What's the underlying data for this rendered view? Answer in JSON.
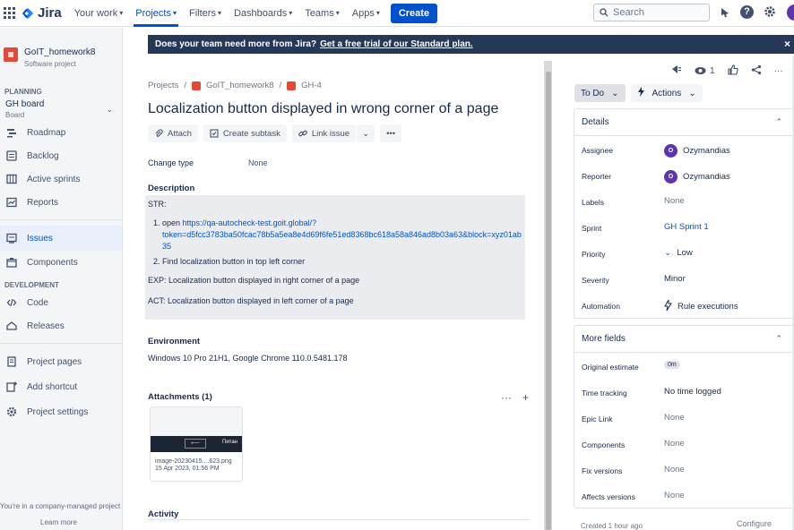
{
  "topnav": {
    "brand": "Jira",
    "items": [
      {
        "label": "Your work",
        "active": false
      },
      {
        "label": "Projects",
        "active": true
      },
      {
        "label": "Filters",
        "active": false
      },
      {
        "label": "Dashboards",
        "active": false
      },
      {
        "label": "Teams",
        "active": false
      },
      {
        "label": "Apps",
        "active": false
      }
    ],
    "create_label": "Create",
    "search_placeholder": "Search"
  },
  "sidebar": {
    "project_name": "GoIT_homework8",
    "project_type": "Software project",
    "planning_label": "PLANNING",
    "board_name": "GH board",
    "board_sub": "Board",
    "planning_items": [
      {
        "label": "Roadmap",
        "icon": "roadmap-icon"
      },
      {
        "label": "Backlog",
        "icon": "backlog-icon"
      },
      {
        "label": "Active sprints",
        "icon": "sprints-icon"
      },
      {
        "label": "Reports",
        "icon": "reports-icon"
      }
    ],
    "issues_label": "Issues",
    "components_label": "Components",
    "development_label": "DEVELOPMENT",
    "dev_items": [
      {
        "label": "Code",
        "icon": "code-icon"
      },
      {
        "label": "Releases",
        "icon": "releases-icon"
      }
    ],
    "bottom_items": [
      {
        "label": "Project pages",
        "icon": "pages-icon"
      },
      {
        "label": "Add shortcut",
        "icon": "add-shortcut-icon"
      },
      {
        "label": "Project settings",
        "icon": "gear-icon"
      }
    ],
    "footer": "You're in a company-managed project",
    "learn_more": "Learn more"
  },
  "banner": {
    "text": "Does your team need more from Jira?",
    "link": "Get a free trial of our Standard plan.",
    "close": "×"
  },
  "issue": {
    "breadcrumb": {
      "projects": "Projects",
      "project": "GoIT_homework8",
      "key": "GH-4",
      "sep": "/"
    },
    "title": "Localization button displayed in wrong corner of a page",
    "actions": {
      "attach": "Attach",
      "subtask": "Create subtask",
      "link": "Link issue",
      "more": "•••"
    },
    "change_type_label": "Change type",
    "change_type_value": "None",
    "description_label": "Description",
    "description": {
      "str": "STR:",
      "step1_prefix": "open ",
      "step1_link_a": "https://qa-autocheck-test.goit.global/?",
      "step1_link_b": "token=d5fcc3783ba50fcac78b5a5ea8e4d69f6fe51ed8368bc618a58a846ad8b03a63&block=xyz01ab",
      "step1_link_c": "35",
      "step2": "Find localization button in top left corner",
      "exp": "EXP: Localization button displayed in right corner of a page",
      "act": "ACT: Localization button displayed in left corner of a page"
    },
    "environment_label": "Environment",
    "environment": "Windows 10 Pro 21H1, Google Chrome 110.0.5481.178",
    "attachments_label": "Attachments (1)",
    "attachment": {
      "name": "image-20230415....623.png",
      "date": "15 Apr 2023, 01:56 PM",
      "thumb_text": "Питан"
    },
    "activity_label": "Activity"
  },
  "right_panel": {
    "watch_count": "1",
    "status": "To Do",
    "actions_label": "Actions",
    "details_label": "Details",
    "details": [
      {
        "label": "Assignee",
        "value": "Ozymandias",
        "type": "user"
      },
      {
        "label": "Reporter",
        "value": "Ozymandias",
        "type": "user"
      },
      {
        "label": "Labels",
        "value": "None",
        "type": "none"
      },
      {
        "label": "Sprint",
        "value": "GH Sprint 1",
        "type": "link"
      },
      {
        "label": "Priority",
        "value": "Low",
        "type": "priority"
      },
      {
        "label": "Severity",
        "value": "Minor",
        "type": "text"
      },
      {
        "label": "Automation",
        "value": "Rule executions",
        "type": "automation"
      }
    ],
    "avatar_initial": "O",
    "more_fields_label": "More fields",
    "more_fields": [
      {
        "label": "Original estimate",
        "value": "0m",
        "type": "pill"
      },
      {
        "label": "Time tracking",
        "value": "No time logged",
        "type": "text"
      },
      {
        "label": "Epic Link",
        "value": "None",
        "type": "none"
      },
      {
        "label": "Components",
        "value": "None",
        "type": "none"
      },
      {
        "label": "Fix versions",
        "value": "None",
        "type": "none"
      },
      {
        "label": "Affects versions",
        "value": "None",
        "type": "none"
      }
    ],
    "footer_created": "Created 1 hour ago",
    "footer_configure": "Configure"
  },
  "colors": {
    "brand": "#0052cc",
    "banner": "#253858",
    "project_icon": "#e5493a",
    "avatar": "#5e35b1"
  }
}
